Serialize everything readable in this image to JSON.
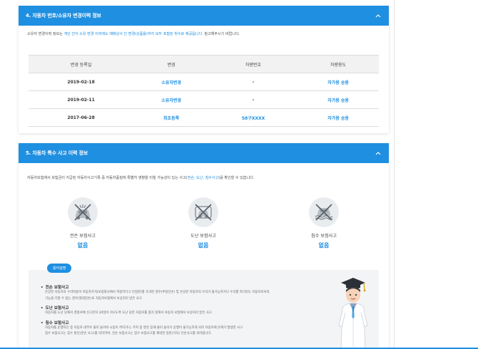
{
  "section4": {
    "title": "4. 자동차 번호/소유자 변경이력 정보",
    "desc_before": "소유자 변경이력 정보는 ",
    "desc_highlight": "개인 간이 소유 변경 이외에도 매매상사 간 변경(상품용)까지 모두 포함된 횟수로 제공됩니다.",
    "desc_after": " 참고해주시기 바랍니다.",
    "headers": [
      "변경 등록일",
      "변경",
      "차량번호",
      "차량용도"
    ],
    "rows": [
      {
        "date": "2019-02-18",
        "change": "소유자변경",
        "plate": "-",
        "usage": "자가용 승용"
      },
      {
        "date": "2019-02-11",
        "change": "소유자변경",
        "plate": "-",
        "usage": "자가용 승용"
      },
      {
        "date": "2017-06-28",
        "change": "최초등록",
        "plate": "58구XXXX",
        "usage": "자가용 승용"
      }
    ]
  },
  "section5": {
    "title": "5. 자동차 특수 사고 이력 정보",
    "desc_before": "자동차보험에서 보험금이 지급된 자동차사고기록 중 자동차품질에 특별히 영향을 미칠 가능성이 있는 사고(",
    "desc_highlight": "전손, 도난, 침수사고",
    "desc_after": ")를 확인할 수 있습니다.",
    "accidents": [
      {
        "label": "전손 보험사고",
        "value": "없음",
        "icon": "crashed-car-icon"
      },
      {
        "label": "도난 보험사고",
        "value": "없음",
        "icon": "stolen-car-icon"
      },
      {
        "label": "침수 보험사고",
        "value": "없음",
        "icon": "flooded-car-icon"
      }
    ],
    "badge": "용어설명",
    "notes": [
      {
        "title": "전손 보험사고",
        "lines": [
          "손상된 자동차의 수리비용이 자동차가치(보험회사에서 적정하다고 인정한)를 초과한 경우(추정전손) 및 손상된 자동차의 수리가 불가능하거나 수리를 하더라도 자동차로서의",
          "기능을 다할 수 없는 경우(절대전손)로 자동차보험에서 보상처리 받은 사고"
        ]
      },
      {
        "title": "도난 보험사고",
        "lines": [
          "자동차를 도난 당해서 경찰서에 신고한지 30일이 지나도록 도난 당한 자동차를 찾지 못해서 자동차 보험에서 보상처리 받은 사고"
        ]
      },
      {
        "title": "침수 보험사고",
        "lines": [
          "자동차를 운행하던 중 자동차 내부로 물이 들어와 시동이 꺼지거나, 주차 중 엔진 등에 물이 들어가 운행이 불가능하게 되어 자동차에 손해가 발생한 사고",
          "침수 보험사고는 침수 원인(분손 사고)를 의미하며, 전손 보험사고는 침수 보험사고를 제외한 일반(기타) 전손사고를 의미합니다."
        ]
      }
    ]
  },
  "colors": {
    "accent": "#1e8fe1",
    "panel": "#f3f4f6"
  }
}
